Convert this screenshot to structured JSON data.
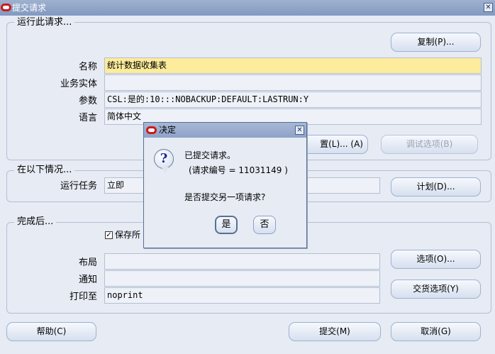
{
  "window": {
    "title": "提交请求",
    "close_glyph": "✕"
  },
  "run_section": {
    "title": "运行此请求...",
    "copy_button": "复制(P)...",
    "fields": {
      "name_label": "名称",
      "name_value": "统计数据收集表",
      "org_label": "业务实体",
      "org_value": "",
      "params_label": "参数",
      "params_value": "CSL:是的:10:::NOBACKUP:DEFAULT:LASTRUN:Y",
      "language_label": "语言",
      "language_value": "简体中文"
    },
    "settings_button_visible": "置(L)... (A)",
    "debug_button": "调试选项(B)"
  },
  "schedule_section": {
    "title": "在以下情况...",
    "run_label": "运行任务",
    "run_value": "立即",
    "schedule_button": "计划(D)..."
  },
  "completion_section": {
    "title": "完成后...",
    "save_checkbox_label": "保存所",
    "layout_label": "布局",
    "layout_value": "",
    "notify_label": "通知",
    "notify_value": "",
    "print_label": "打印至",
    "print_value": "noprint",
    "options_button": "选项(O)...",
    "delivery_button": "交货选项(Y)"
  },
  "footer": {
    "help_button": "帮助(C)",
    "submit_button": "提交(M)",
    "cancel_button": "取消(G)"
  },
  "dialog": {
    "title": "决定",
    "message_line1": "已提交请求。",
    "message_line2": "(请求编号 = 11031149 )",
    "question": "是否提交另一项请求?",
    "yes_button": "是",
    "no_button": "否",
    "icon": "question-icon"
  },
  "colors": {
    "background": "#e6ebf4",
    "title_bar": "#8ea3c8",
    "highlight_field": "#fcec9b",
    "oracle_logo": "#cc1a1a"
  }
}
